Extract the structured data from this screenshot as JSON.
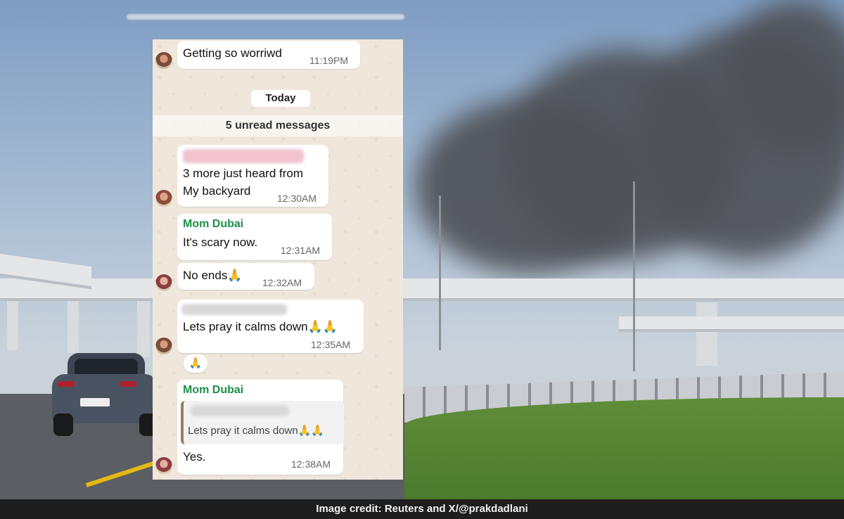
{
  "chat": {
    "messages": [
      {
        "text": "Getting so worriwd",
        "time": "11:19PM"
      },
      {
        "text": "3 more just heard from\nMy backyard",
        "time": "12:30AM"
      },
      {
        "sender": "Mom Dubai",
        "text": "It's scary now.",
        "time": "12:31AM"
      },
      {
        "text": "No ends🙏",
        "time": "12:32AM"
      },
      {
        "text": "Lets pray it calms down🙏🙏",
        "time": "12:35AM"
      },
      {
        "reaction": "🙏"
      },
      {
        "sender": "Mom Dubai",
        "quoted": "Lets pray it calms down🙏🙏",
        "text": "Yes.",
        "time": "12:38AM"
      }
    ],
    "date_divider": "Today",
    "unread_banner": "5 unread messages"
  },
  "caption": "Image credit: Reuters and X/@prakdadlani",
  "colors": {
    "sender_name": "#1f8f4a",
    "chat_bg": "#efe7dc",
    "caption_bg": "#1d1d1d"
  }
}
